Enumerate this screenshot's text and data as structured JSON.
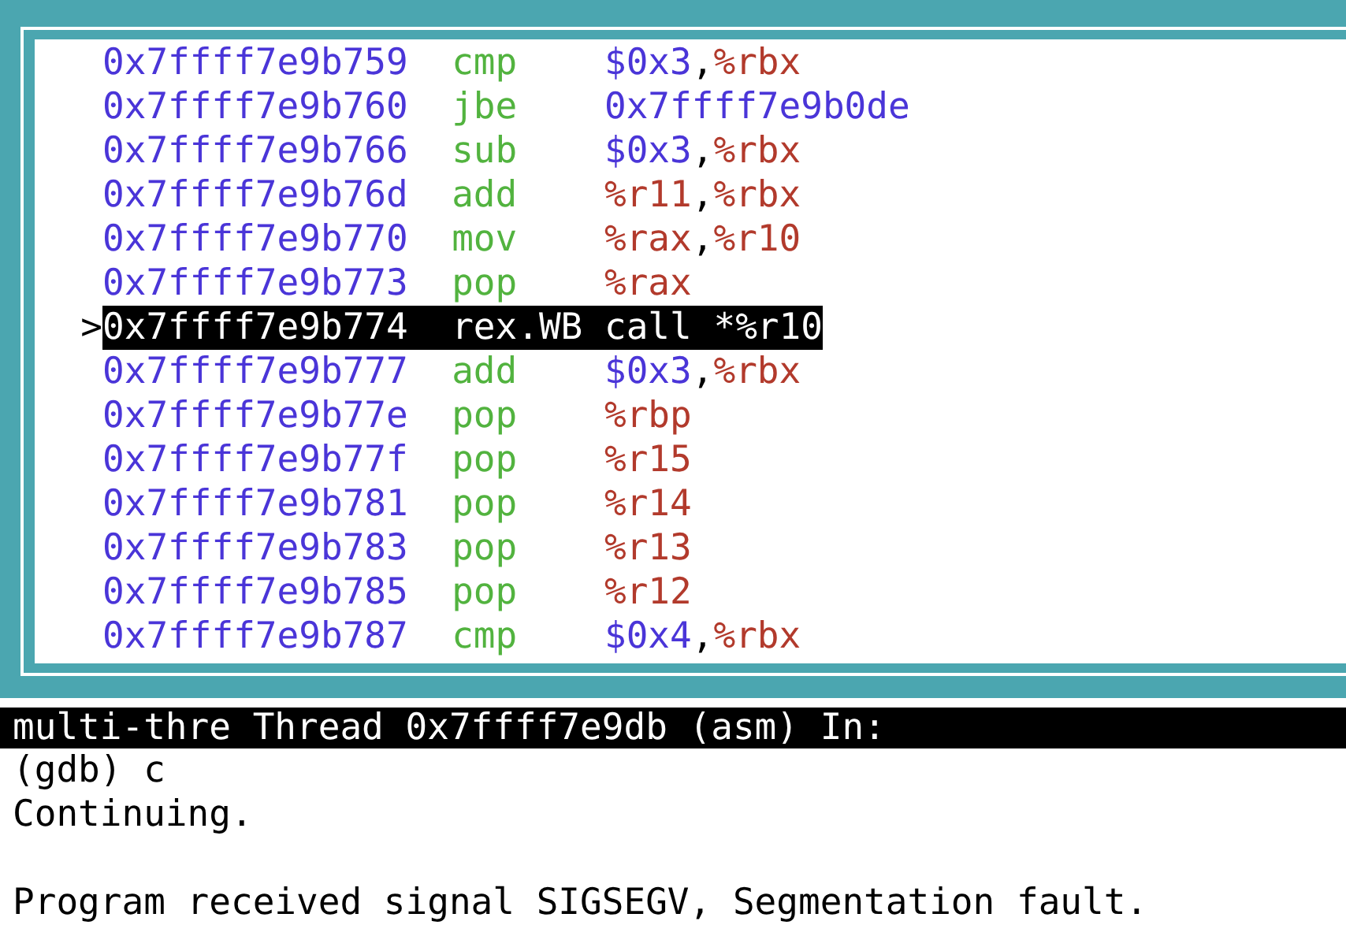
{
  "asm_lines": [
    {
      "address": "0x7ffff7e9b759",
      "mnemonic": "cmp",
      "operands": [
        {
          "text": "$0x3",
          "kind": "immediate"
        },
        {
          "text": ",",
          "kind": "punct"
        },
        {
          "text": "%rbx",
          "kind": "register"
        }
      ],
      "selected": false
    },
    {
      "address": "0x7ffff7e9b760",
      "mnemonic": "jbe",
      "operands": [
        {
          "text": "0x7ffff7e9b0de",
          "kind": "address"
        }
      ],
      "selected": false
    },
    {
      "address": "0x7ffff7e9b766",
      "mnemonic": "sub",
      "operands": [
        {
          "text": "$0x3",
          "kind": "immediate"
        },
        {
          "text": ",",
          "kind": "punct"
        },
        {
          "text": "%rbx",
          "kind": "register"
        }
      ],
      "selected": false
    },
    {
      "address": "0x7ffff7e9b76d",
      "mnemonic": "add",
      "operands": [
        {
          "text": "%r11",
          "kind": "register"
        },
        {
          "text": ",",
          "kind": "punct"
        },
        {
          "text": "%rbx",
          "kind": "register"
        }
      ],
      "selected": false
    },
    {
      "address": "0x7ffff7e9b770",
      "mnemonic": "mov",
      "operands": [
        {
          "text": "%rax",
          "kind": "register"
        },
        {
          "text": ",",
          "kind": "punct"
        },
        {
          "text": "%r10",
          "kind": "register"
        }
      ],
      "selected": false
    },
    {
      "address": "0x7ffff7e9b773",
      "mnemonic": "pop",
      "operands": [
        {
          "text": "%rax",
          "kind": "register"
        }
      ],
      "selected": false
    },
    {
      "address": "0x7ffff7e9b774",
      "mnemonic": "rex.WB",
      "operands": [
        {
          "text": "call *%r10",
          "kind": "plain"
        }
      ],
      "selected": true,
      "marker": ">"
    },
    {
      "address": "0x7ffff7e9b777",
      "mnemonic": "add",
      "operands": [
        {
          "text": "$0x3",
          "kind": "immediate"
        },
        {
          "text": ",",
          "kind": "punct"
        },
        {
          "text": "%rbx",
          "kind": "register"
        }
      ],
      "selected": false
    },
    {
      "address": "0x7ffff7e9b77e",
      "mnemonic": "pop",
      "operands": [
        {
          "text": "%rbp",
          "kind": "register"
        }
      ],
      "selected": false
    },
    {
      "address": "0x7ffff7e9b77f",
      "mnemonic": "pop",
      "operands": [
        {
          "text": "%r15",
          "kind": "register"
        }
      ],
      "selected": false
    },
    {
      "address": "0x7ffff7e9b781",
      "mnemonic": "pop",
      "operands": [
        {
          "text": "%r14",
          "kind": "register"
        }
      ],
      "selected": false
    },
    {
      "address": "0x7ffff7e9b783",
      "mnemonic": "pop",
      "operands": [
        {
          "text": "%r13",
          "kind": "register"
        }
      ],
      "selected": false
    },
    {
      "address": "0x7ffff7e9b785",
      "mnemonic": "pop",
      "operands": [
        {
          "text": "%r12",
          "kind": "register"
        }
      ],
      "selected": false
    },
    {
      "address": "0x7ffff7e9b787",
      "mnemonic": "cmp",
      "operands": [
        {
          "text": "$0x4",
          "kind": "immediate"
        },
        {
          "text": ",",
          "kind": "punct"
        },
        {
          "text": "%rbx",
          "kind": "register"
        }
      ],
      "selected": false
    }
  ],
  "status_bar": "multi-thre Thread 0x7ffff7e9db (asm) In:",
  "console_blocks": [
    {
      "lines": [
        "(gdb) c",
        "Continuing."
      ]
    },
    {
      "lines": [
        "Program received signal SIGSEGV, Segmentation fault."
      ]
    }
  ]
}
